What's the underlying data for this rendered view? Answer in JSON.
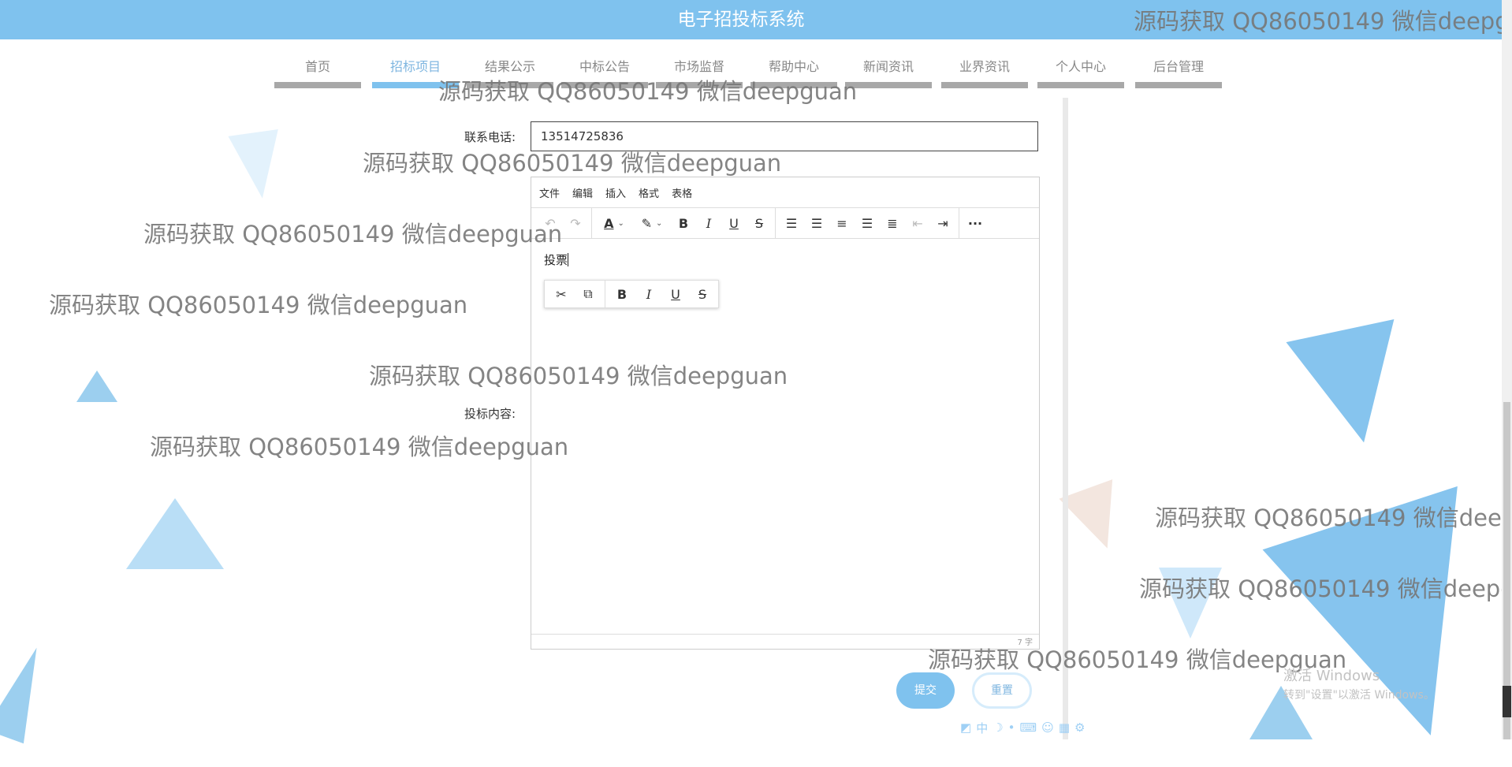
{
  "header": {
    "title": "电子招投标系统"
  },
  "nav": {
    "items": [
      {
        "label": "首页",
        "active": false
      },
      {
        "label": "招标项目",
        "active": true
      },
      {
        "label": "结果公示",
        "active": false
      },
      {
        "label": "中标公告",
        "active": false
      },
      {
        "label": "市场监督",
        "active": false
      },
      {
        "label": "帮助中心",
        "active": false
      },
      {
        "label": "新闻资讯",
        "active": false
      },
      {
        "label": "业界资讯",
        "active": false
      },
      {
        "label": "个人中心",
        "active": false
      },
      {
        "label": "后台管理",
        "active": false
      }
    ]
  },
  "form": {
    "phone_label": "联系电话:",
    "phone_value": "13514725836",
    "content_label": "投标内容:"
  },
  "editor": {
    "menu": [
      "文件",
      "编辑",
      "插入",
      "格式",
      "表格"
    ],
    "content_text": "投票",
    "word_count": "7 字",
    "toolbar_icons": [
      "undo-icon",
      "redo-icon",
      "font-color-icon",
      "highlight-icon",
      "bold-icon",
      "italic-icon",
      "underline-icon",
      "strikethrough-icon",
      "bullet-list-icon",
      "align-left-icon",
      "align-center-icon",
      "align-right-icon",
      "align-justify-icon",
      "outdent-icon",
      "indent-icon",
      "more-icon"
    ],
    "quick_toolbar_icons": [
      "cut-icon",
      "copy-icon",
      "bold-icon",
      "italic-icon",
      "underline-icon",
      "strikethrough-icon"
    ]
  },
  "buttons": {
    "submit": "提交",
    "reset": "重置"
  },
  "watermark": {
    "text": "源码获取 QQ86050149 微信deepguan",
    "text_clipped_1": "源码获取 QQ86050149 微信deepg",
    "text_clipped_2": "源码获取 QQ86050149 微信deep",
    "text_clipped_3": "源码获取 QQ86050149 微信deepg"
  },
  "system_overlay": {
    "activate_title": "激活 Windows",
    "activate_hint": "转到\"设置\"以激活 Windows。",
    "ime_label": "中"
  },
  "colors": {
    "primary": "#7fc2ee",
    "nav_active": "#7fb6e0",
    "nav_bar": "#a8a8a8"
  }
}
